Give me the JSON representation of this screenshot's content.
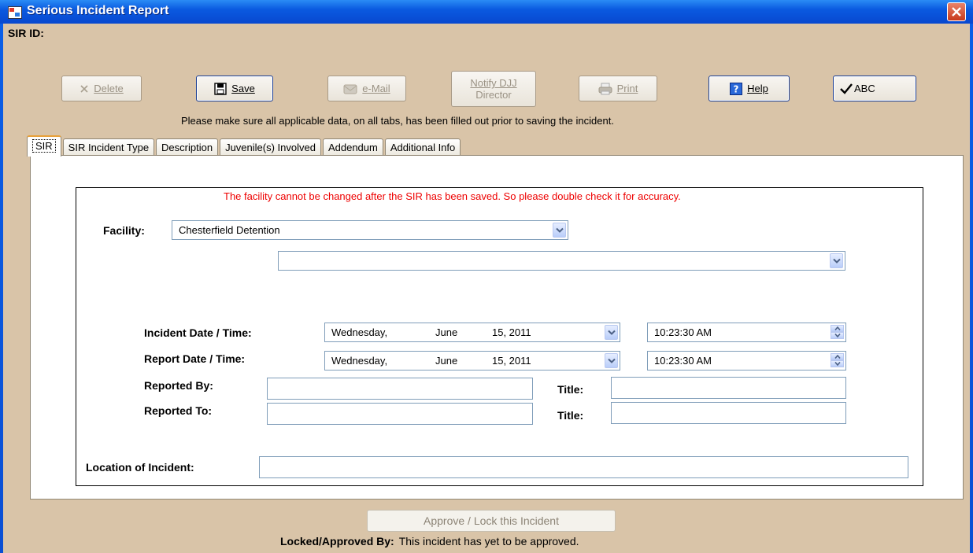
{
  "window": {
    "title": "Serious Incident Report"
  },
  "header": {
    "sir_id_label": "SIR ID:"
  },
  "toolbar": {
    "delete": {
      "label": "Delete",
      "enabled": false
    },
    "save": {
      "label": "Save",
      "enabled": true
    },
    "email": {
      "label": "e-Mail",
      "enabled": false
    },
    "notify": {
      "line1": "Notify DJJ",
      "line2": "Director",
      "enabled": false
    },
    "print": {
      "label": "Print",
      "enabled": false
    },
    "help": {
      "label": "Help",
      "enabled": true
    },
    "spell": {
      "label": "ABC",
      "enabled": true
    }
  },
  "notice": "Please make sure all applicable data, on all tabs, has been filled out prior to saving the incident.",
  "tabs": [
    {
      "label": "SIR",
      "active": true
    },
    {
      "label": "SIR Incident Type",
      "active": false
    },
    {
      "label": "Description",
      "active": false
    },
    {
      "label": "Juvenile(s) Involved",
      "active": false
    },
    {
      "label": "Addendum",
      "active": false
    },
    {
      "label": "Additional Info",
      "active": false
    }
  ],
  "form": {
    "warning": "The facility cannot be changed after the SIR has been saved.  So please double check it for accuracy.",
    "facility_label": "Facility:",
    "facility_value": "Chesterfield Detention",
    "sub_facility_value": "",
    "incident_dt_label": "Incident Date / Time:",
    "incident_date": {
      "weekday": "Wednesday,",
      "month": "June",
      "day_year": "15, 2011"
    },
    "incident_time": "10:23:30 AM",
    "report_dt_label": "Report Date / Time:",
    "report_date": {
      "weekday": "Wednesday,",
      "month": "June",
      "day_year": "15, 2011"
    },
    "report_time": "10:23:30 AM",
    "reported_by_label": "Reported By:",
    "reported_by_value": "",
    "reported_to_label": "Reported To:",
    "reported_to_value": "",
    "title_label": "Title:",
    "title1_value": "",
    "title2_value": "",
    "location_label": "Location of Incident:",
    "location_value": ""
  },
  "footer": {
    "approve_label": "Approve / Lock this Incident",
    "locked_label": "Locked/Approved By:",
    "locked_value": "This incident has yet to be approved."
  },
  "colors": {
    "titlebar": "#0a5ae0",
    "client_bg": "#d9c4a8",
    "warning": "#e00000",
    "active_tab_accent": "#e8a038"
  }
}
